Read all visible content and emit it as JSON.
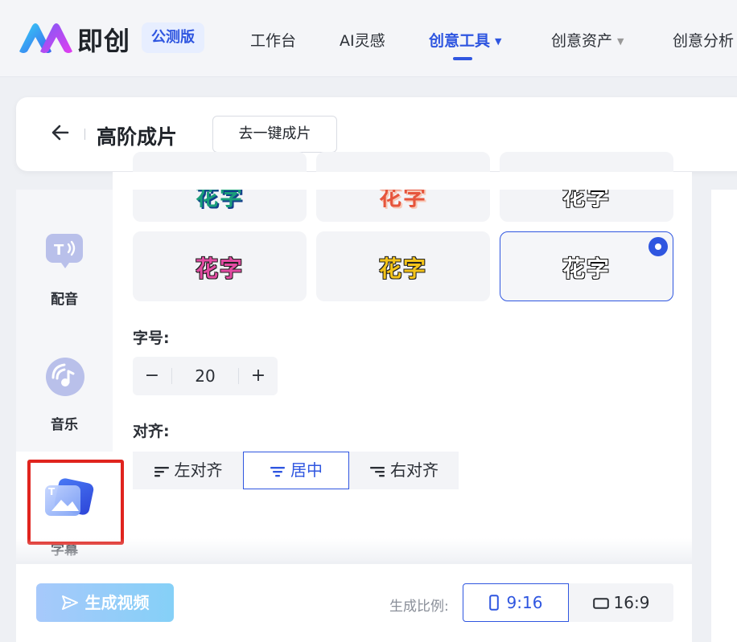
{
  "app": {
    "brand": "即创",
    "beta_badge": "公测版"
  },
  "nav": {
    "items": [
      {
        "label": "工作台"
      },
      {
        "label": "AI灵感"
      },
      {
        "label": "创意工具",
        "active": true
      },
      {
        "label": "创意资产"
      },
      {
        "label": "创意分析"
      }
    ],
    "colors": {
      "active": "#2f56e0",
      "inactive": "#2b2f36"
    }
  },
  "header": {
    "title": "高阶成片",
    "quick_button": "去一键成片"
  },
  "sidebar": {
    "items": [
      {
        "label": "配音",
        "icon": "tts-speech-icon"
      },
      {
        "label": "音乐",
        "icon": "music-disc-icon"
      },
      {
        "label": "字幕",
        "icon": "subtitle-image-icon",
        "active": true
      }
    ]
  },
  "styles": {
    "cards": [
      {
        "text": "花字",
        "color": "#1a9e7a"
      },
      {
        "text": "花字",
        "color": "#e6553c"
      },
      {
        "text": "花字",
        "color": "#ffffff"
      },
      {
        "text": "花字",
        "color": "#e24ba2"
      },
      {
        "text": "花字",
        "color": "#f3c31a"
      },
      {
        "text": "花字",
        "color": "#ffffff",
        "selected": true
      }
    ]
  },
  "font_size": {
    "label": "字号:",
    "value": "20",
    "minus": "−",
    "plus": "+"
  },
  "alignment": {
    "label": "对齐:",
    "options": [
      {
        "label": "左对齐",
        "icon": "align-left-icon"
      },
      {
        "label": "居中",
        "icon": "align-center-icon",
        "selected": true
      },
      {
        "label": "右对齐",
        "icon": "align-right-icon"
      }
    ]
  },
  "footer": {
    "generate_button": "生成视频",
    "ratio_label": "生成比例:",
    "ratios": [
      {
        "label": "9:16",
        "icon": "portrait-phone-icon",
        "selected": true
      },
      {
        "label": "16:9",
        "icon": "landscape-screen-icon"
      }
    ]
  },
  "colors": {
    "accent": "#2f56e0",
    "highlight_annotation": "#e0241e"
  }
}
